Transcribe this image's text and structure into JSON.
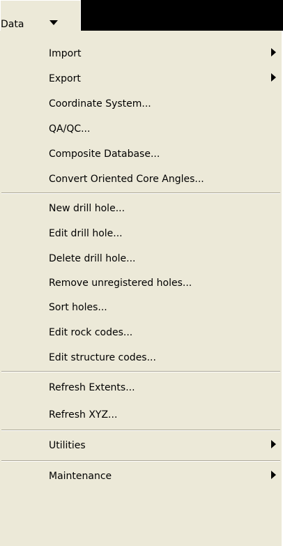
{
  "menu": {
    "title": "Data",
    "items": [
      {
        "label": "Import",
        "has_submenu": true
      },
      {
        "label": "Export",
        "has_submenu": true
      },
      {
        "label": "Coordinate System..."
      },
      {
        "label": "QA/QC..."
      },
      {
        "label": "Composite Database..."
      },
      {
        "label": "Convert Oriented Core Angles..."
      },
      {
        "label": "New drill hole..."
      },
      {
        "label": "Edit drill hole..."
      },
      {
        "label": "Delete drill hole..."
      },
      {
        "label": "Remove unregistered holes..."
      },
      {
        "label": "Sort holes..."
      },
      {
        "label": "Edit rock codes..."
      },
      {
        "label": "Edit structure codes..."
      },
      {
        "label": "Refresh Extents..."
      },
      {
        "label": "Refresh XYZ..."
      },
      {
        "label": "Utilities",
        "has_submenu": true
      },
      {
        "label": "Maintenance",
        "has_submenu": true
      }
    ]
  },
  "colors": {
    "menu_background": "#ece9d8",
    "outside_background": "#000000",
    "separator_dark": "#aca899",
    "separator_light": "#ffffff"
  }
}
